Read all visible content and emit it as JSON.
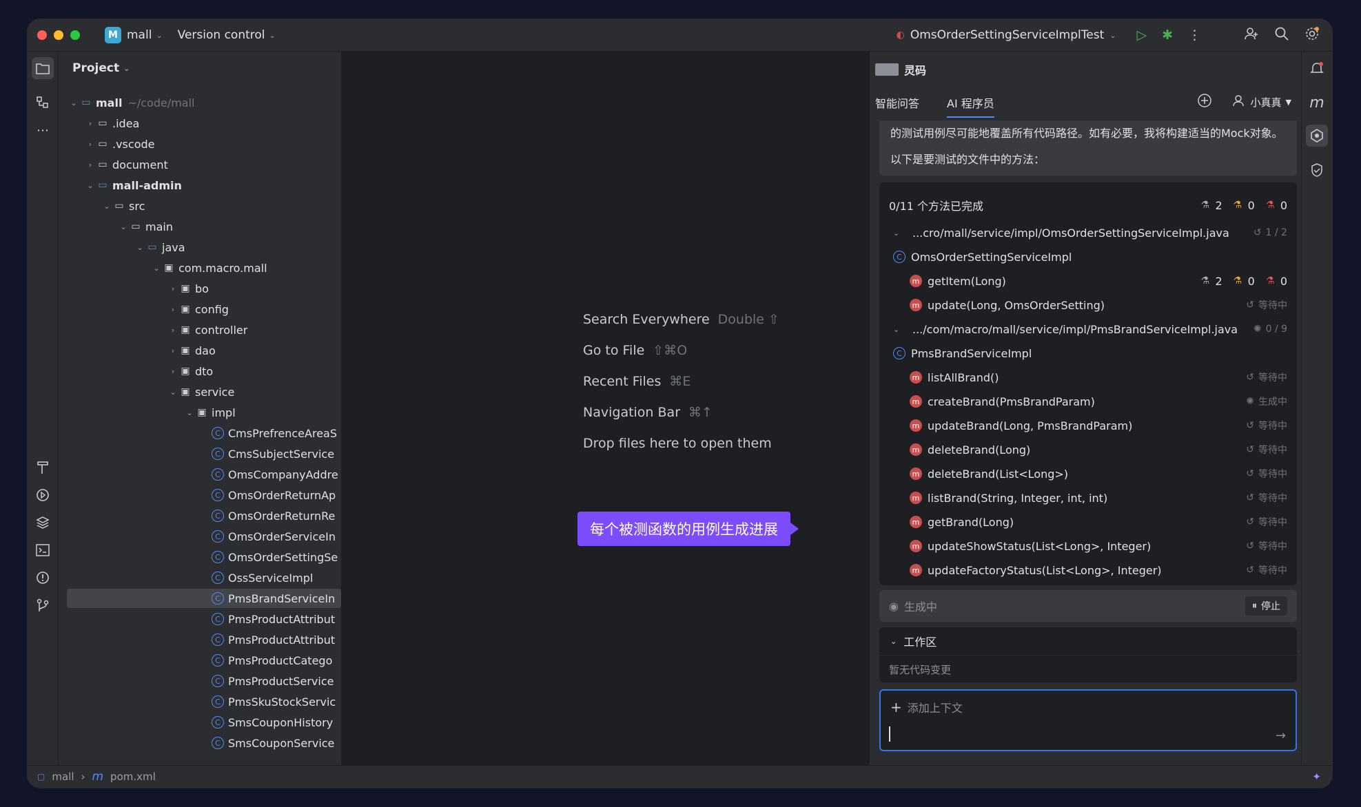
{
  "titlebar": {
    "project_badge": "M",
    "project_name": "mall",
    "vcs": "Version control",
    "run_config": "OmsOrderSettingServiceImplTest"
  },
  "project_panel": {
    "title": "Project",
    "tree": [
      {
        "depth": 0,
        "arrow": "open",
        "icon": "module",
        "label": "mall",
        "bold": true,
        "path": "~/code/mall"
      },
      {
        "depth": 1,
        "arrow": "closed",
        "icon": "folder",
        "label": ".idea"
      },
      {
        "depth": 1,
        "arrow": "closed",
        "icon": "folder",
        "label": ".vscode"
      },
      {
        "depth": 1,
        "arrow": "closed",
        "icon": "folder",
        "label": "document"
      },
      {
        "depth": 1,
        "arrow": "open",
        "icon": "module",
        "label": "mall-admin",
        "bold": true
      },
      {
        "depth": 2,
        "arrow": "open",
        "icon": "folder",
        "label": "src"
      },
      {
        "depth": 3,
        "arrow": "open",
        "icon": "folder",
        "label": "main"
      },
      {
        "depth": 4,
        "arrow": "open",
        "icon": "folder-src",
        "label": "java"
      },
      {
        "depth": 5,
        "arrow": "open",
        "icon": "package",
        "label": "com.macro.mall"
      },
      {
        "depth": 6,
        "arrow": "closed",
        "icon": "package",
        "label": "bo"
      },
      {
        "depth": 6,
        "arrow": "closed",
        "icon": "package",
        "label": "config"
      },
      {
        "depth": 6,
        "arrow": "closed",
        "icon": "package",
        "label": "controller"
      },
      {
        "depth": 6,
        "arrow": "closed",
        "icon": "package",
        "label": "dao"
      },
      {
        "depth": 6,
        "arrow": "closed",
        "icon": "package",
        "label": "dto"
      },
      {
        "depth": 6,
        "arrow": "open",
        "icon": "package",
        "label": "service"
      },
      {
        "depth": 7,
        "arrow": "open",
        "icon": "package",
        "label": "impl"
      },
      {
        "depth": 8,
        "icon": "class",
        "label": "CmsPrefrenceAreaS"
      },
      {
        "depth": 8,
        "icon": "class",
        "label": "CmsSubjectService"
      },
      {
        "depth": 8,
        "icon": "class",
        "label": "OmsCompanyAddre"
      },
      {
        "depth": 8,
        "icon": "class",
        "label": "OmsOrderReturnAp"
      },
      {
        "depth": 8,
        "icon": "class",
        "label": "OmsOrderReturnRe"
      },
      {
        "depth": 8,
        "icon": "class",
        "label": "OmsOrderServiceIn"
      },
      {
        "depth": 8,
        "icon": "class",
        "label": "OmsOrderSettingSe"
      },
      {
        "depth": 8,
        "icon": "class",
        "label": "OssServiceImpl"
      },
      {
        "depth": 8,
        "icon": "class",
        "label": "PmsBrandServiceIn",
        "selected": true
      },
      {
        "depth": 8,
        "icon": "class",
        "label": "PmsProductAttribut"
      },
      {
        "depth": 8,
        "icon": "class",
        "label": "PmsProductAttribut"
      },
      {
        "depth": 8,
        "icon": "class",
        "label": "PmsProductCatego"
      },
      {
        "depth": 8,
        "icon": "class",
        "label": "PmsProductService"
      },
      {
        "depth": 8,
        "icon": "class",
        "label": "PmsSkuStockServic"
      },
      {
        "depth": 8,
        "icon": "class",
        "label": "SmsCouponHistory"
      },
      {
        "depth": 8,
        "icon": "class",
        "label": "SmsCouponService"
      }
    ]
  },
  "editor": {
    "hints": [
      {
        "label": "Search Everywhere",
        "shortcut": "Double ⇧"
      },
      {
        "label": "Go to File",
        "shortcut": "⇧⌘O"
      },
      {
        "label": "Recent Files",
        "shortcut": "⌘E"
      },
      {
        "label": "Navigation Bar",
        "shortcut": "⌘↑"
      },
      {
        "label": "Drop files here to open them",
        "shortcut": ""
      }
    ],
    "callout": "每个被测函数的用例生成进展"
  },
  "ai_panel": {
    "title": "灵码",
    "tabs": [
      "智能问答",
      "AI 程序员"
    ],
    "active_tab": 1,
    "user": "小真真",
    "message_lines": [
      "的测试用例尽可能地覆盖所有代码路径。如有必要，我将构建适当的Mock对象。",
      "以下是要测试的文件中的方法："
    ],
    "progress_summary": "0/11 个方法已完成",
    "summary_counts": {
      "pass": "2",
      "warn": "0",
      "fail": "0"
    },
    "rows": [
      {
        "type": "file",
        "label": "...cro/mall/service/impl/OmsOrderSettingServiceImpl.java",
        "status_icon": "history",
        "status": "1 / 2"
      },
      {
        "type": "class",
        "label": "OmsOrderSettingServiceImpl"
      },
      {
        "type": "method",
        "label": "getItem(Long)",
        "counts": {
          "pass": "2",
          "warn": "0",
          "fail": "0"
        }
      },
      {
        "type": "method",
        "label": "update(Long, OmsOrderSetting)",
        "status_icon": "history",
        "status": "等待中"
      },
      {
        "type": "file",
        "label": ".../com/macro/mall/service/impl/PmsBrandServiceImpl.java",
        "status_icon": "spinner",
        "status": "0 / 9"
      },
      {
        "type": "class",
        "label": "PmsBrandServiceImpl"
      },
      {
        "type": "method",
        "label": "listAllBrand()",
        "status_icon": "history",
        "status": "等待中"
      },
      {
        "type": "method",
        "label": "createBrand(PmsBrandParam)",
        "status_icon": "spinner",
        "status": "生成中"
      },
      {
        "type": "method",
        "label": "updateBrand(Long, PmsBrandParam)",
        "status_icon": "history",
        "status": "等待中"
      },
      {
        "type": "method",
        "label": "deleteBrand(Long)",
        "status_icon": "history",
        "status": "等待中"
      },
      {
        "type": "method",
        "label": "deleteBrand(List<Long>)",
        "status_icon": "history",
        "status": "等待中"
      },
      {
        "type": "method",
        "label": "listBrand(String, Integer, int, int)",
        "status_icon": "history",
        "status": "等待中"
      },
      {
        "type": "method",
        "label": "getBrand(Long)",
        "status_icon": "history",
        "status": "等待中"
      },
      {
        "type": "method",
        "label": "updateShowStatus(List<Long>, Integer)",
        "status_icon": "history",
        "status": "等待中"
      },
      {
        "type": "method",
        "label": "updateFactoryStatus(List<Long>, Integer)",
        "status_icon": "history",
        "status": "等待中"
      }
    ],
    "generating_label": "生成中",
    "stop_label": "停止",
    "workspace_title": "工作区",
    "workspace_empty": "暂无代码变更",
    "add_context": "添加上下文"
  },
  "statusbar": {
    "crumb1": "mall",
    "crumb2": "pom.xml"
  },
  "colors": {
    "accent": "#3574f0",
    "callout": "#7b4dff",
    "run_green": "#4caf50",
    "method_red": "#c94f4f"
  }
}
